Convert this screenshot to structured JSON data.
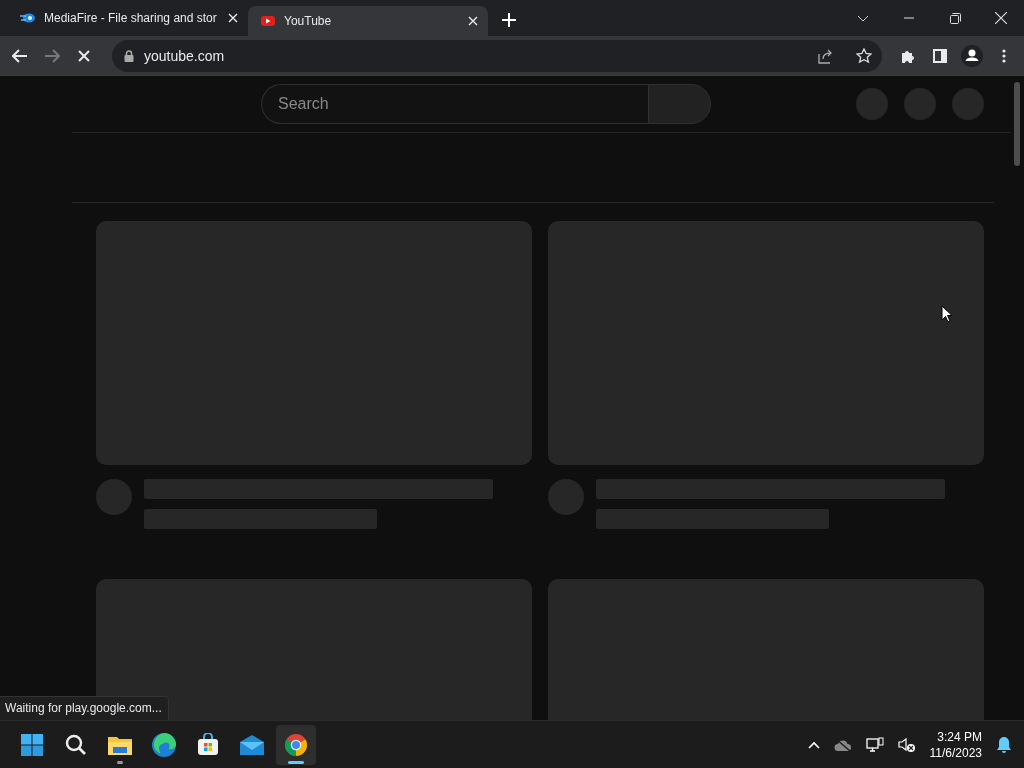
{
  "browser": {
    "tabs": [
      {
        "title": "MediaFire - File sharing and stor",
        "selected": false,
        "kind": "mediafire"
      },
      {
        "title": "YouTube",
        "selected": true,
        "kind": "youtube"
      }
    ],
    "address": "youtube.com",
    "loading": true
  },
  "page": {
    "search": {
      "placeholder": "Search"
    }
  },
  "status_bubble": "Waiting for play.google.com...",
  "taskbar": {
    "apps": [
      {
        "kind": "start",
        "selected": false
      },
      {
        "kind": "search",
        "selected": false
      },
      {
        "kind": "explorer",
        "selected": false,
        "running": true
      },
      {
        "kind": "edge",
        "selected": false,
        "running": false
      },
      {
        "kind": "store",
        "selected": false,
        "running": false
      },
      {
        "kind": "mail",
        "selected": false,
        "running": false
      },
      {
        "kind": "chrome",
        "selected": true,
        "running": true
      }
    ],
    "time": "3:24 PM",
    "date": "11/6/2023"
  }
}
